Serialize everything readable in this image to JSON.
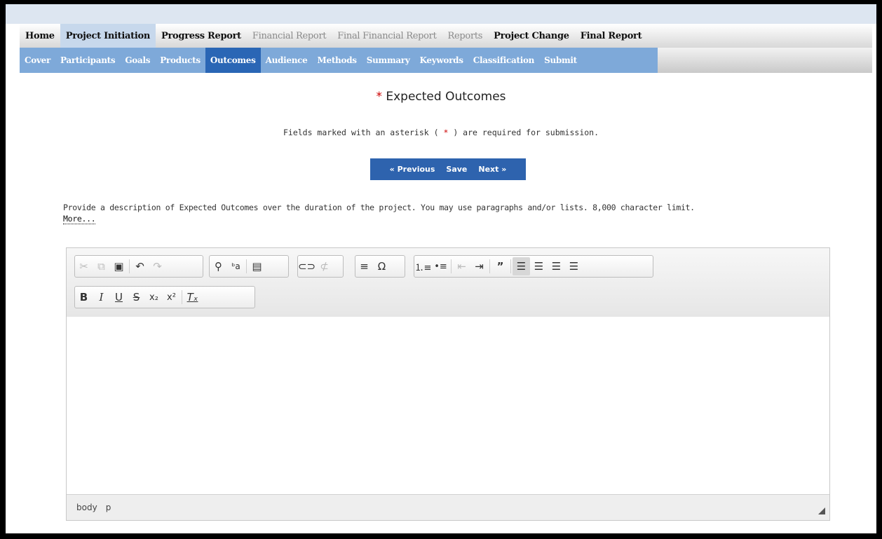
{
  "nav_top": [
    {
      "label": "Home",
      "state": "normal"
    },
    {
      "label": "Project Initiation",
      "state": "active"
    },
    {
      "label": "Progress Report",
      "state": "normal"
    },
    {
      "label": "Financial Report",
      "state": "disabled"
    },
    {
      "label": "Final Financial Report",
      "state": "disabled"
    },
    {
      "label": "Reports",
      "state": "disabled"
    },
    {
      "label": "Project Change",
      "state": "normal"
    },
    {
      "label": "Final Report",
      "state": "normal"
    }
  ],
  "nav_sub": [
    {
      "label": "Cover"
    },
    {
      "label": "Participants"
    },
    {
      "label": "Goals"
    },
    {
      "label": "Products"
    },
    {
      "label": "Outcomes",
      "active": true
    },
    {
      "label": "Audience"
    },
    {
      "label": "Methods"
    },
    {
      "label": "Summary"
    },
    {
      "label": "Keywords"
    },
    {
      "label": "Classification"
    },
    {
      "label": "Submit"
    }
  ],
  "page": {
    "required_mark": "*",
    "title": "Expected Outcomes",
    "note_pre": "Fields marked with an asterisk ( ",
    "note_mark": "*",
    "note_post": " ) are required for submission.",
    "prev_label": "« Previous",
    "save_label": "Save",
    "next_label": "Next »",
    "description": "Provide a description of Expected Outcomes over the duration of the project.  You may use paragraphs and/or lists. 8,000 character limit.",
    "more_link": "More..."
  },
  "editor": {
    "status_path": [
      "body",
      "p"
    ],
    "content": ""
  },
  "colors": {
    "active_tab": "#2a66b5",
    "sub_nav": "#7ea9d9",
    "required": "#cc0000",
    "buttons": "#2e63ae"
  }
}
